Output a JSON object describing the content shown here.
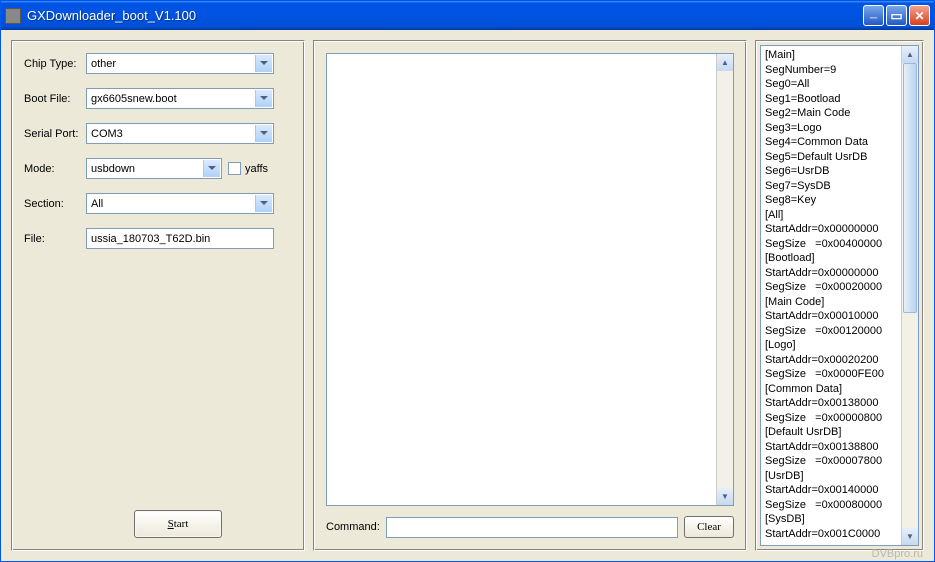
{
  "window": {
    "title": "GXDownloader_boot_V1.100"
  },
  "form": {
    "chip_type_label": "Chip Type:",
    "chip_type_value": "other",
    "boot_file_label": "Boot File:",
    "boot_file_value": "gx6605snew.boot",
    "serial_port_label": "Serial Port:",
    "serial_port_value": "COM3",
    "mode_label": "Mode:",
    "mode_value": "usbdown",
    "yaffs_label": "yaffs",
    "yaffs_checked": false,
    "section_label": "Section:",
    "section_value": "All",
    "file_label": "File:",
    "file_value": "ussia_180703_T62D.bin"
  },
  "buttons": {
    "start_prefix": "S",
    "start_rest": "tart",
    "clear": "Clear"
  },
  "command": {
    "label": "Command:",
    "value": ""
  },
  "log_lines": [
    "[Main]",
    "SegNumber=9",
    "Seg0=All",
    "Seg1=Bootload",
    "Seg2=Main Code",
    "Seg3=Logo",
    "Seg4=Common Data",
    "Seg5=Default UsrDB",
    "Seg6=UsrDB",
    "Seg7=SysDB",
    "Seg8=Key",
    "[All]",
    "StartAddr=0x00000000",
    "SegSize   =0x00400000",
    "[Bootload]",
    "StartAddr=0x00000000",
    "SegSize   =0x00020000",
    "[Main Code]",
    "StartAddr=0x00010000",
    "SegSize   =0x00120000",
    "[Logo]",
    "StartAddr=0x00020200",
    "SegSize   =0x0000FE00",
    "[Common Data]",
    "StartAddr=0x00138000",
    "SegSize   =0x00000800",
    "[Default UsrDB]",
    "StartAddr=0x00138800",
    "SegSize   =0x00007800",
    "[UsrDB]",
    "StartAddr=0x00140000",
    "SegSize   =0x00080000",
    "[SysDB]",
    "StartAddr=0x001C0000"
  ],
  "watermark": "DVBpro.ru"
}
